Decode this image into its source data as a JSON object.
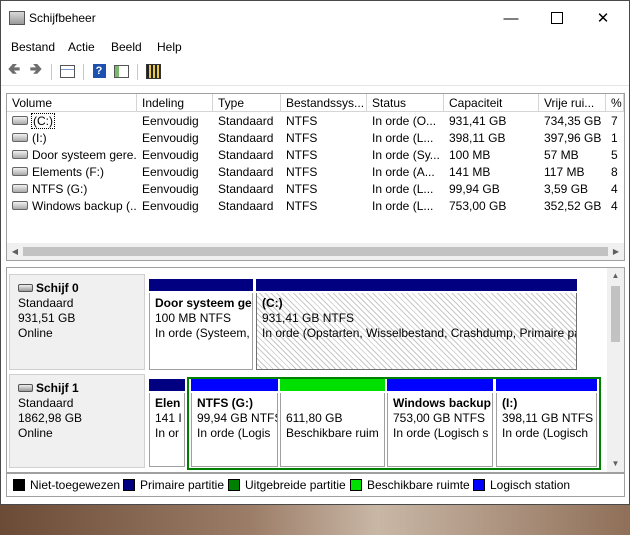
{
  "window": {
    "title": "Schijfbeheer"
  },
  "menu": [
    "Bestand",
    "Actie",
    "Beeld",
    "Help"
  ],
  "columns": [
    "Volume",
    "Indeling",
    "Type",
    "Bestandssys...",
    "Status",
    "Capaciteit",
    "Vrije rui...",
    "%"
  ],
  "volumes": [
    [
      "(C:)",
      "Eenvoudig",
      "Standaard",
      "NTFS",
      "In orde (O...",
      "931,41 GB",
      "734,35 GB",
      "7"
    ],
    [
      "(I:)",
      "Eenvoudig",
      "Standaard",
      "NTFS",
      "In orde (L...",
      "398,11 GB",
      "397,96 GB",
      "1"
    ],
    [
      "Door systeem gere...",
      "Eenvoudig",
      "Standaard",
      "NTFS",
      "In orde (Sy...",
      "100 MB",
      "57 MB",
      "5"
    ],
    [
      "Elements (F:)",
      "Eenvoudig",
      "Standaard",
      "NTFS",
      "In orde (A...",
      "141 MB",
      "117 MB",
      "8"
    ],
    [
      "NTFS (G:)",
      "Eenvoudig",
      "Standaard",
      "NTFS",
      "In orde (L...",
      "99,94 GB",
      "3,59 GB",
      "4"
    ],
    [
      "Windows backup (...",
      "Eenvoudig",
      "Standaard",
      "NTFS",
      "In orde (L...",
      "753,00 GB",
      "352,52 GB",
      "4"
    ]
  ],
  "disks": [
    {
      "name": "Schijf 0",
      "type": "Standaard",
      "size": "931,51 GB",
      "state": "Online",
      "partitions": [
        {
          "name": "Door systeem ge",
          "size": "100 MB NTFS",
          "status": "In orde (Systeem,"
        },
        {
          "name": "(C:)",
          "size": "931,41 GB NTFS",
          "status": "In orde (Opstarten, Wisselbestand, Crashdump, Primaire pa"
        }
      ]
    },
    {
      "name": "Schijf 1",
      "type": "Standaard",
      "size": "1862,98 GB",
      "state": "Online",
      "partitions": [
        {
          "name": "Elen",
          "size": "141 I",
          "status": "In or"
        },
        {
          "name": "NTFS  (G:)",
          "size": "99,94 GB NTFS",
          "status": "In orde (Logis"
        },
        {
          "name": "",
          "size": "611,80 GB",
          "status": "Beschikbare ruim"
        },
        {
          "name": "Windows backup",
          "size": "753,00 GB NTFS",
          "status": "In orde (Logisch s"
        },
        {
          "name": "(I:)",
          "size": "398,11 GB NTFS",
          "status": "In orde (Logisch"
        }
      ]
    }
  ],
  "legend": [
    {
      "label": "Niet-toegewezen",
      "color": "#000000"
    },
    {
      "label": "Primaire partitie",
      "color": "#000080"
    },
    {
      "label": "Uitgebreide partitie",
      "color": "#008000"
    },
    {
      "label": "Beschikbare ruimte",
      "color": "#00e000"
    },
    {
      "label": "Logisch station",
      "color": "#0000ff"
    }
  ],
  "icons": {
    "back": "arrow-left-icon",
    "forward": "arrow-right-icon",
    "properties": "properties-icon",
    "help": "help-icon",
    "console": "console-icon",
    "settings": "settings-icon"
  }
}
